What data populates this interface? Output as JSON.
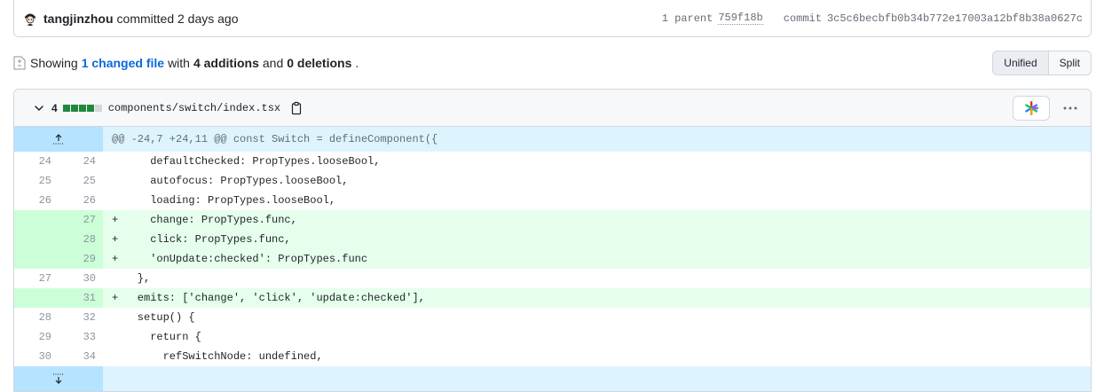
{
  "commit": {
    "author": "tangjinzhou",
    "action": "committed 2 days ago",
    "parent_label": "1 parent",
    "parent_sha": "759f18b",
    "commit_label": "commit",
    "commit_sha": "3c5c6becbfb0b34b772e17003a12bf8b38a0627c"
  },
  "summary": {
    "showing": "Showing",
    "changed_files": "1 changed file",
    "with": "with",
    "additions": "4 additions",
    "and": "and",
    "deletions": "0 deletions",
    "period": ".",
    "view_unified": "Unified",
    "view_split": "Split"
  },
  "file": {
    "change_count": "4",
    "path": "components/switch/index.tsx",
    "diffstat": [
      "add",
      "add",
      "add",
      "add",
      "neu"
    ]
  },
  "hunk_header": "@@ -24,7 +24,11 @@ const Switch = defineComponent({",
  "lines": [
    {
      "type": "ctx",
      "old": "24",
      "new": "24",
      "text": "      defaultChecked: PropTypes.looseBool,"
    },
    {
      "type": "ctx",
      "old": "25",
      "new": "25",
      "text": "      autofocus: PropTypes.looseBool,"
    },
    {
      "type": "ctx",
      "old": "26",
      "new": "26",
      "text": "      loading: PropTypes.looseBool,"
    },
    {
      "type": "add",
      "old": "",
      "new": "27",
      "text": "+     change: PropTypes.func,"
    },
    {
      "type": "add",
      "old": "",
      "new": "28",
      "text": "+     click: PropTypes.func,"
    },
    {
      "type": "add",
      "old": "",
      "new": "29",
      "text": "+     'onUpdate:checked': PropTypes.func"
    },
    {
      "type": "ctx",
      "old": "27",
      "new": "30",
      "text": "    },"
    },
    {
      "type": "add",
      "old": "",
      "new": "31",
      "text": "+   emits: ['change', 'click', 'update:checked'],"
    },
    {
      "type": "ctx",
      "old": "28",
      "new": "32",
      "text": "    setup() {"
    },
    {
      "type": "ctx",
      "old": "29",
      "new": "33",
      "text": "      return {"
    },
    {
      "type": "ctx",
      "old": "30",
      "new": "34",
      "text": "        refSwitchNode: undefined,"
    }
  ]
}
